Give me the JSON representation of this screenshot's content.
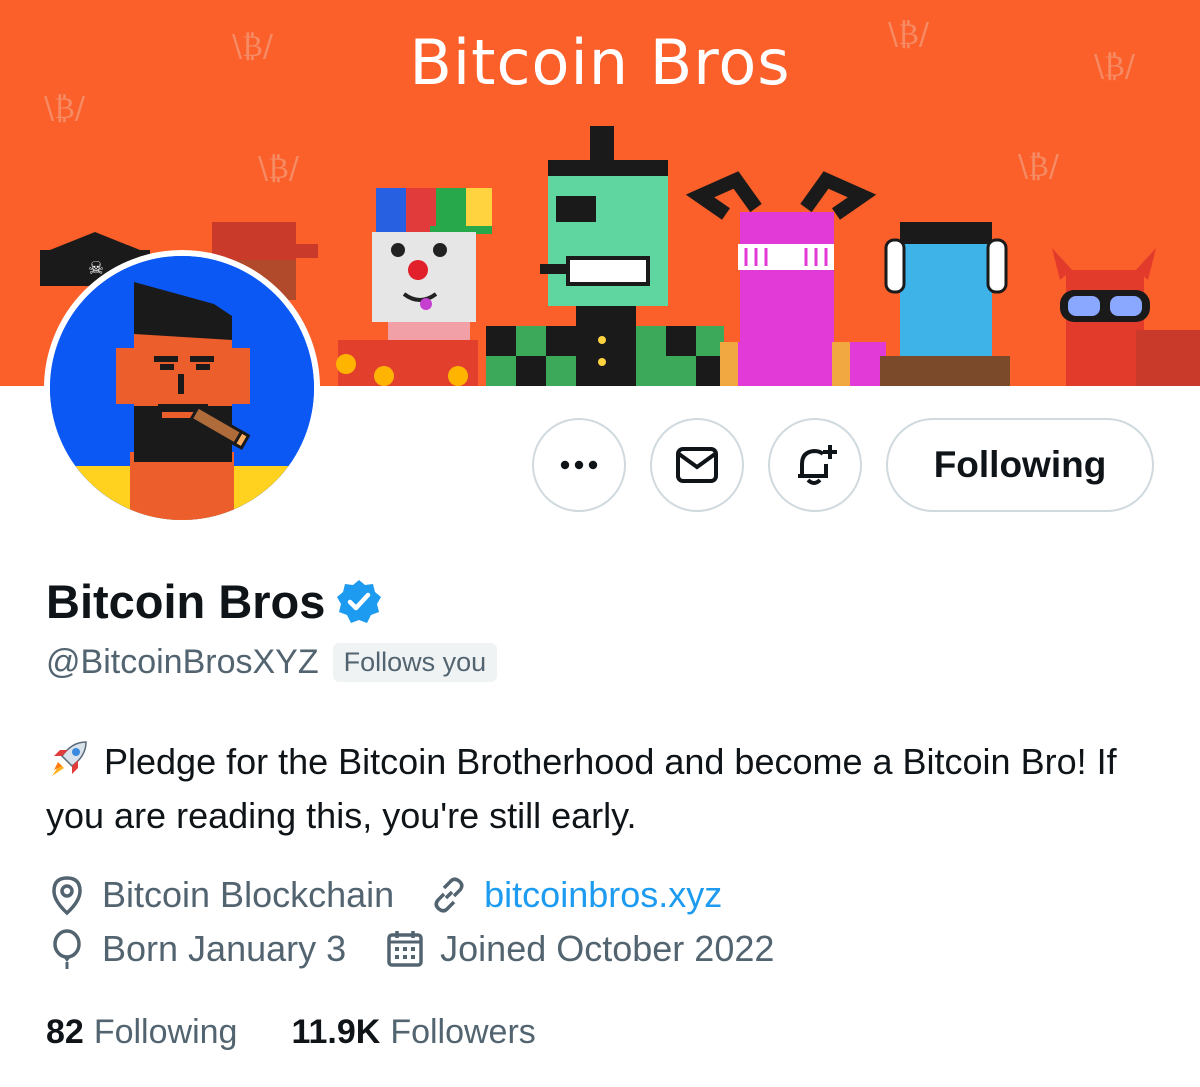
{
  "banner": {
    "title": "Bitcoin Bros",
    "background_color": "#fb5f2a"
  },
  "actions": {
    "more_icon": "more-dots-icon",
    "message_icon": "envelope-icon",
    "notify_icon": "bell-plus-icon",
    "following_label": "Following"
  },
  "profile": {
    "display_name": "Bitcoin Bros",
    "verified": true,
    "handle": "@BitcoinBrosXYZ",
    "follows_you_label": "Follows you",
    "bio_emoji": "rocket-icon",
    "bio": "Pledge for the Bitcoin Brotherhood and become a Bitcoin Bro! If you are reading this, you're still early.",
    "location": "Bitcoin Blockchain",
    "website": "bitcoinbros.xyz",
    "birthday": "Born January 3",
    "joined": "Joined October 2022"
  },
  "stats": {
    "following_count": "82",
    "following_label": "Following",
    "followers_count": "11.9K",
    "followers_label": "Followers"
  },
  "colors": {
    "link": "#1d9bf0",
    "secondary_text": "#536471",
    "primary_text": "#0f1419",
    "border": "#cfd9de"
  }
}
